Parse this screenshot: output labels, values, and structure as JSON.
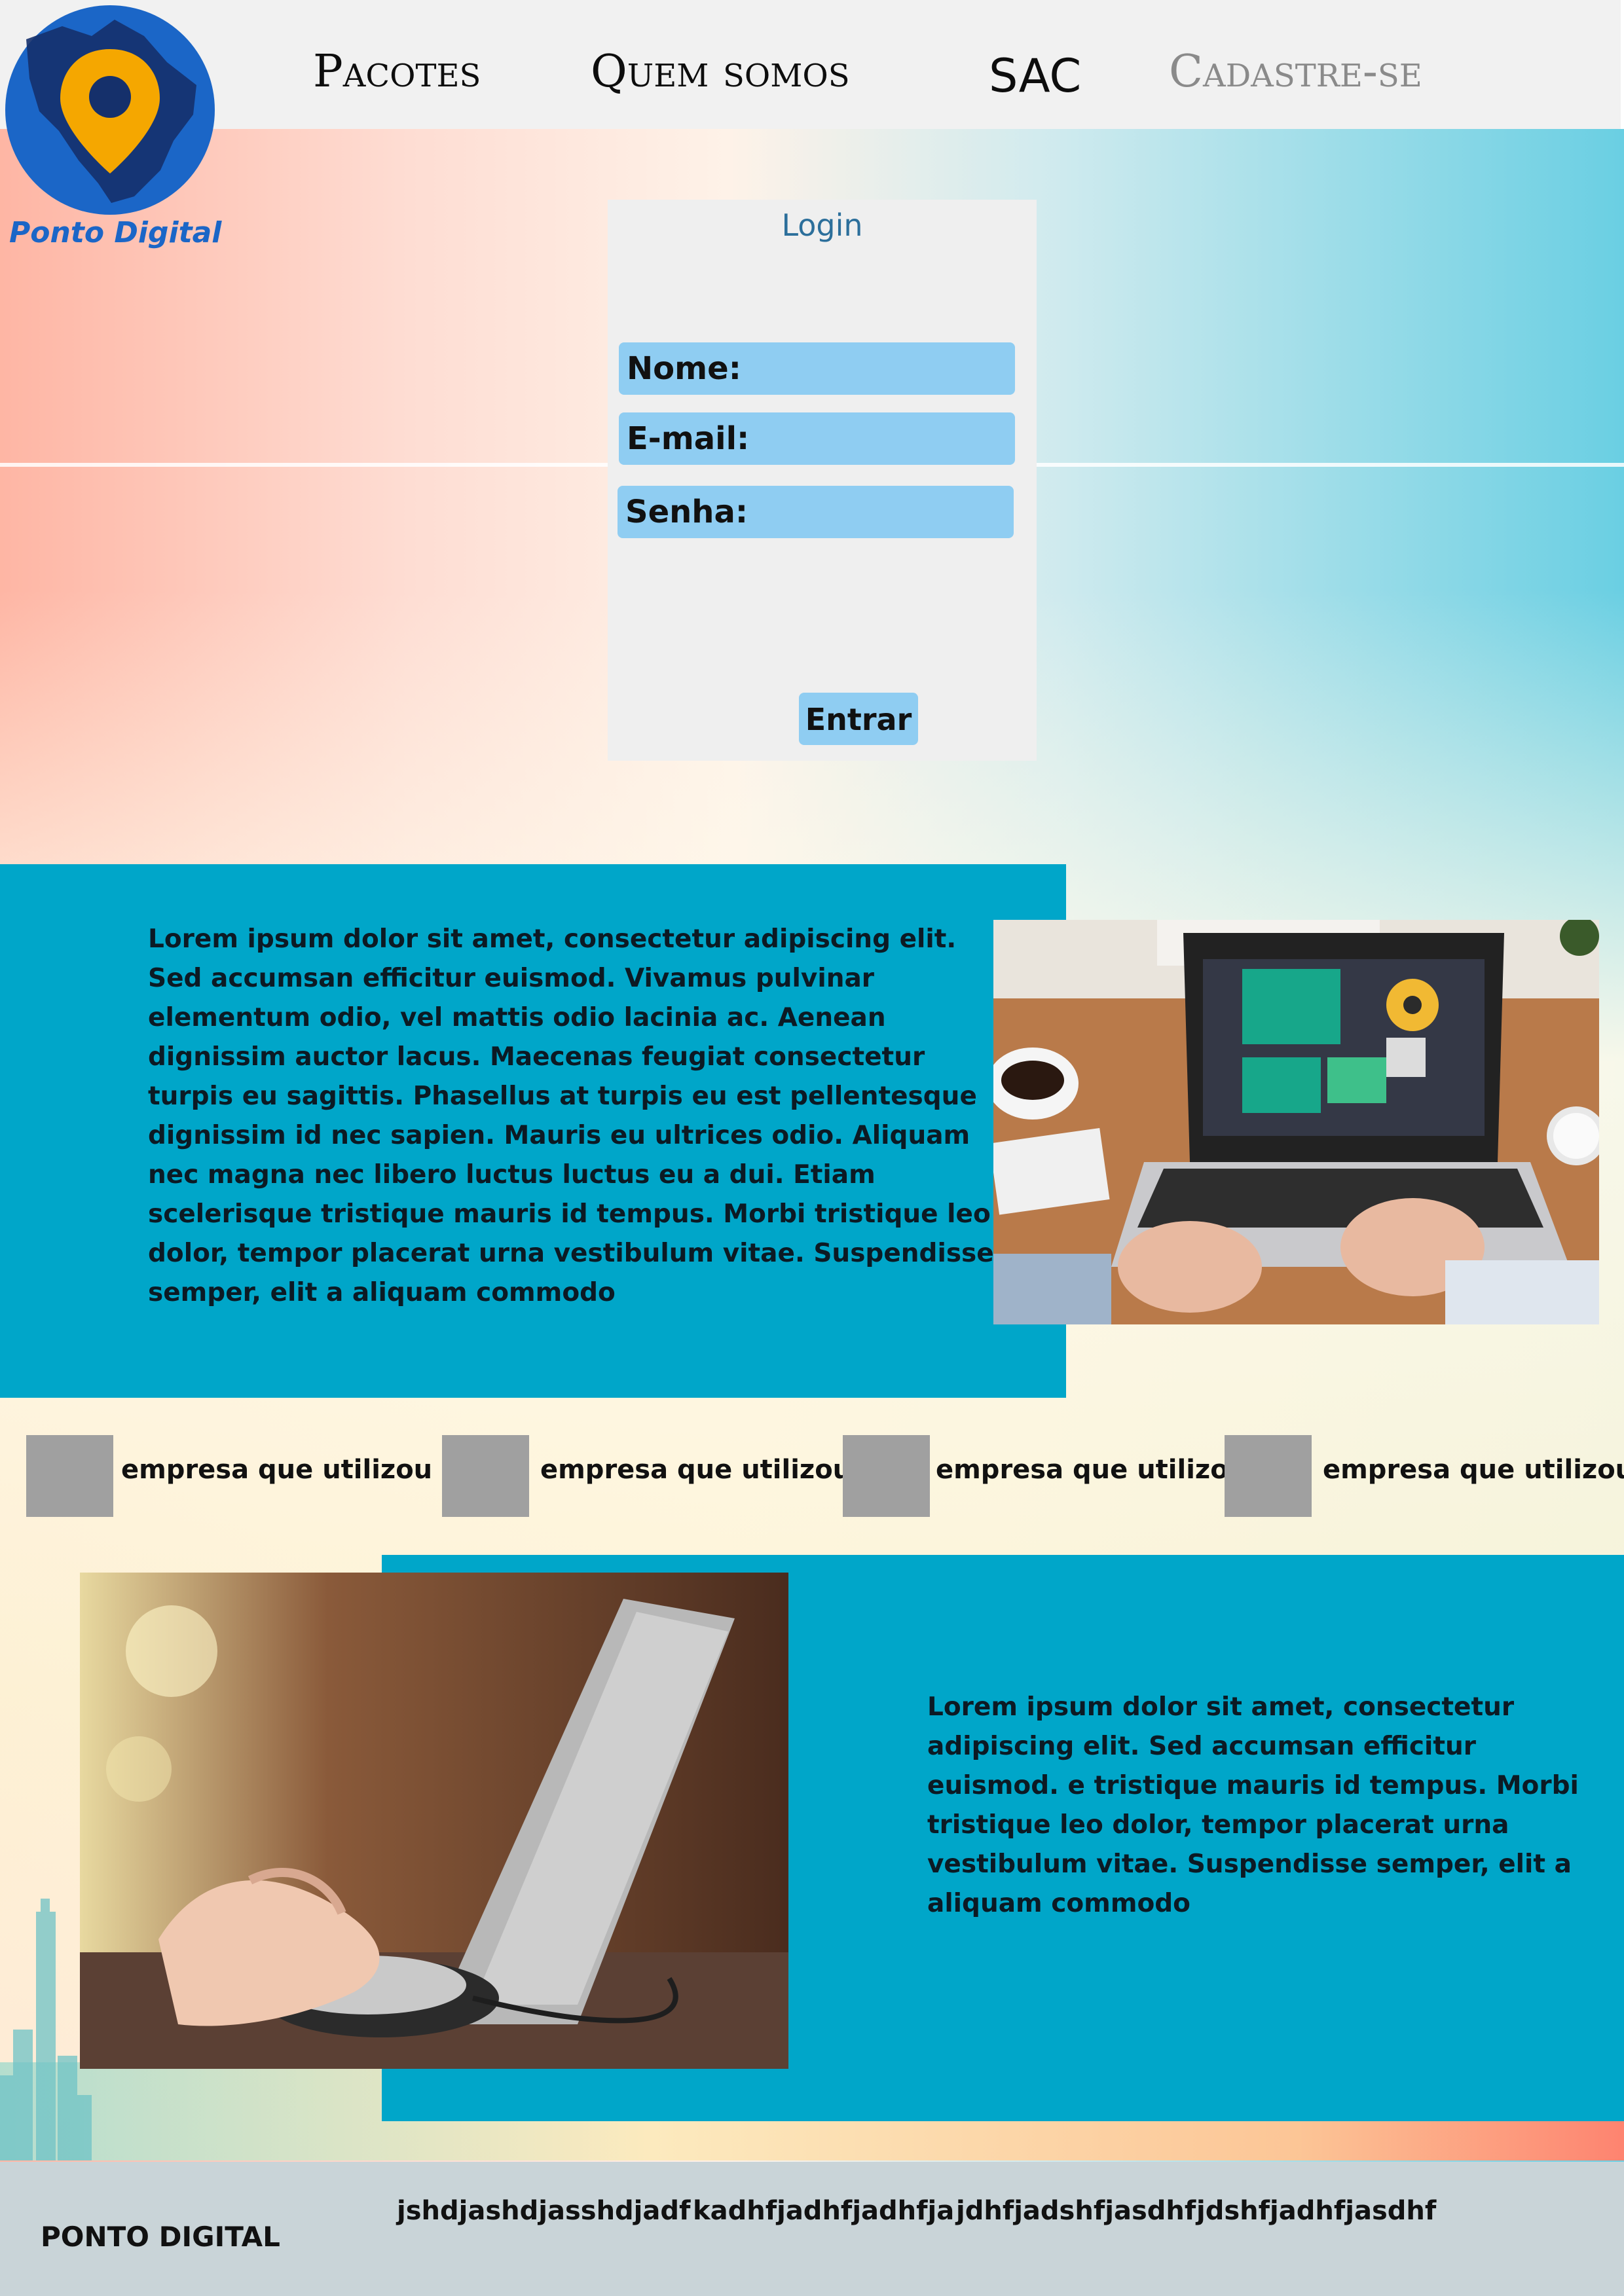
{
  "brand": {
    "name": "Ponto Digital",
    "primary_color": "#00a6c9",
    "logo_color": "#1b66c7",
    "pin_color": "#f5a700"
  },
  "nav": {
    "items": [
      {
        "label": "Pacotes"
      },
      {
        "label": "Quem somos"
      },
      {
        "label": "SAC"
      },
      {
        "label": "Cadastre-se"
      }
    ]
  },
  "login": {
    "title": "Login",
    "fields": {
      "nome": "Nome:",
      "email": "E-mail:",
      "senha": "Senha:"
    },
    "submit_label": "Entrar"
  },
  "section1": {
    "text": "Lorem ipsum dolor sit amet, consectetur adipiscing elit. Sed accumsan efficitur euismod. Vivamus pulvinar elementum odio, vel mattis odio lacinia ac. Aenean dignissim auctor lacus. Maecenas feugiat consectetur turpis eu sagittis. Phasellus at turpis eu est pellentesque dignissim id nec sapien. Mauris eu ultrices odio. Aliquam nec magna nec libero luctus luctus eu a dui. Etiam scelerisque tristique mauris id tempus. Morbi tristique leo dolor, tempor placerat urna vestibulum vitae. Suspendisse semper, elit a aliquam commodo"
  },
  "companies": [
    {
      "label": "empresa que utilizou"
    },
    {
      "label": "empresa que utilizou"
    },
    {
      "label": "empresa que utilizou"
    },
    {
      "label": "empresa que utilizou"
    }
  ],
  "section2": {
    "text": "Lorem ipsum dolor sit amet, consectetur adipiscing elit. Sed accumsan efficitur euismod. e tristique mauris id tempus. Morbi tristique leo dolor, tempor placerat urna vestibulum vitae. Suspendisse semper, elit a aliquam commodo"
  },
  "footer": {
    "brand": "PONTO DIGITAL",
    "links": [
      "jshdjashdjasshdjadf",
      "kadhfjadhfjadhfja",
      "jdhfjadshfjasdhf",
      "jdshfjadhfjasdhf"
    ]
  }
}
